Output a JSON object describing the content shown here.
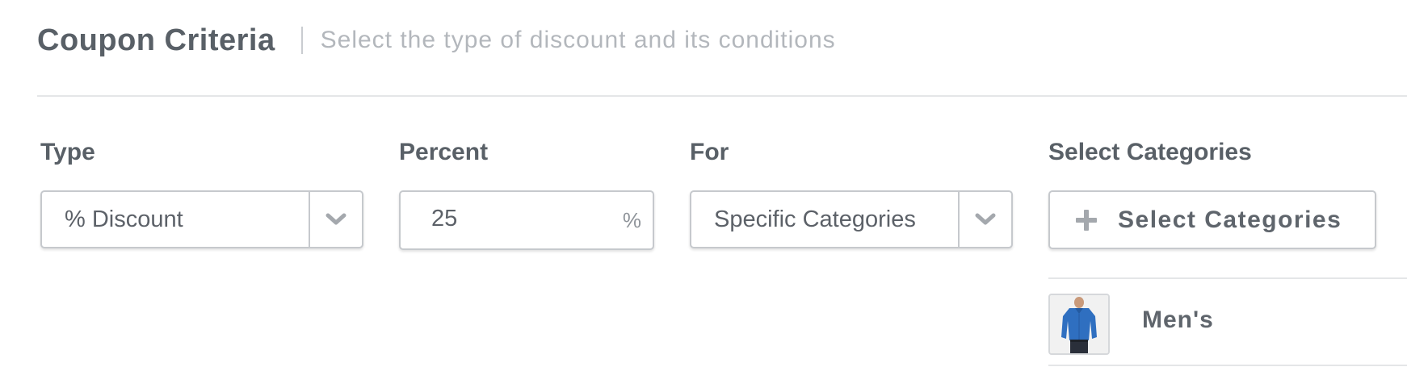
{
  "header": {
    "title": "Coupon Criteria",
    "subtitle": "Select the type of discount and its conditions"
  },
  "fields": {
    "type": {
      "label": "Type",
      "value": "% Discount",
      "icon": "chevron-down-icon"
    },
    "percent": {
      "label": "Percent",
      "value": "25",
      "suffix": "%"
    },
    "for": {
      "label": "For",
      "value": "Specific Categories",
      "icon": "chevron-down-icon"
    },
    "categories": {
      "label": "Select Categories",
      "button_label": "Select Categories",
      "button_icon": "plus-icon"
    }
  },
  "selected_categories": [
    {
      "name": "Men's",
      "thumbnail": "shirt-thumbnail"
    }
  ],
  "colors": {
    "text": "#596067",
    "muted": "#b3b7bc",
    "border": "#c6c9cd",
    "icon": "#a4a8ad",
    "shirt": "#2f6fc0"
  }
}
